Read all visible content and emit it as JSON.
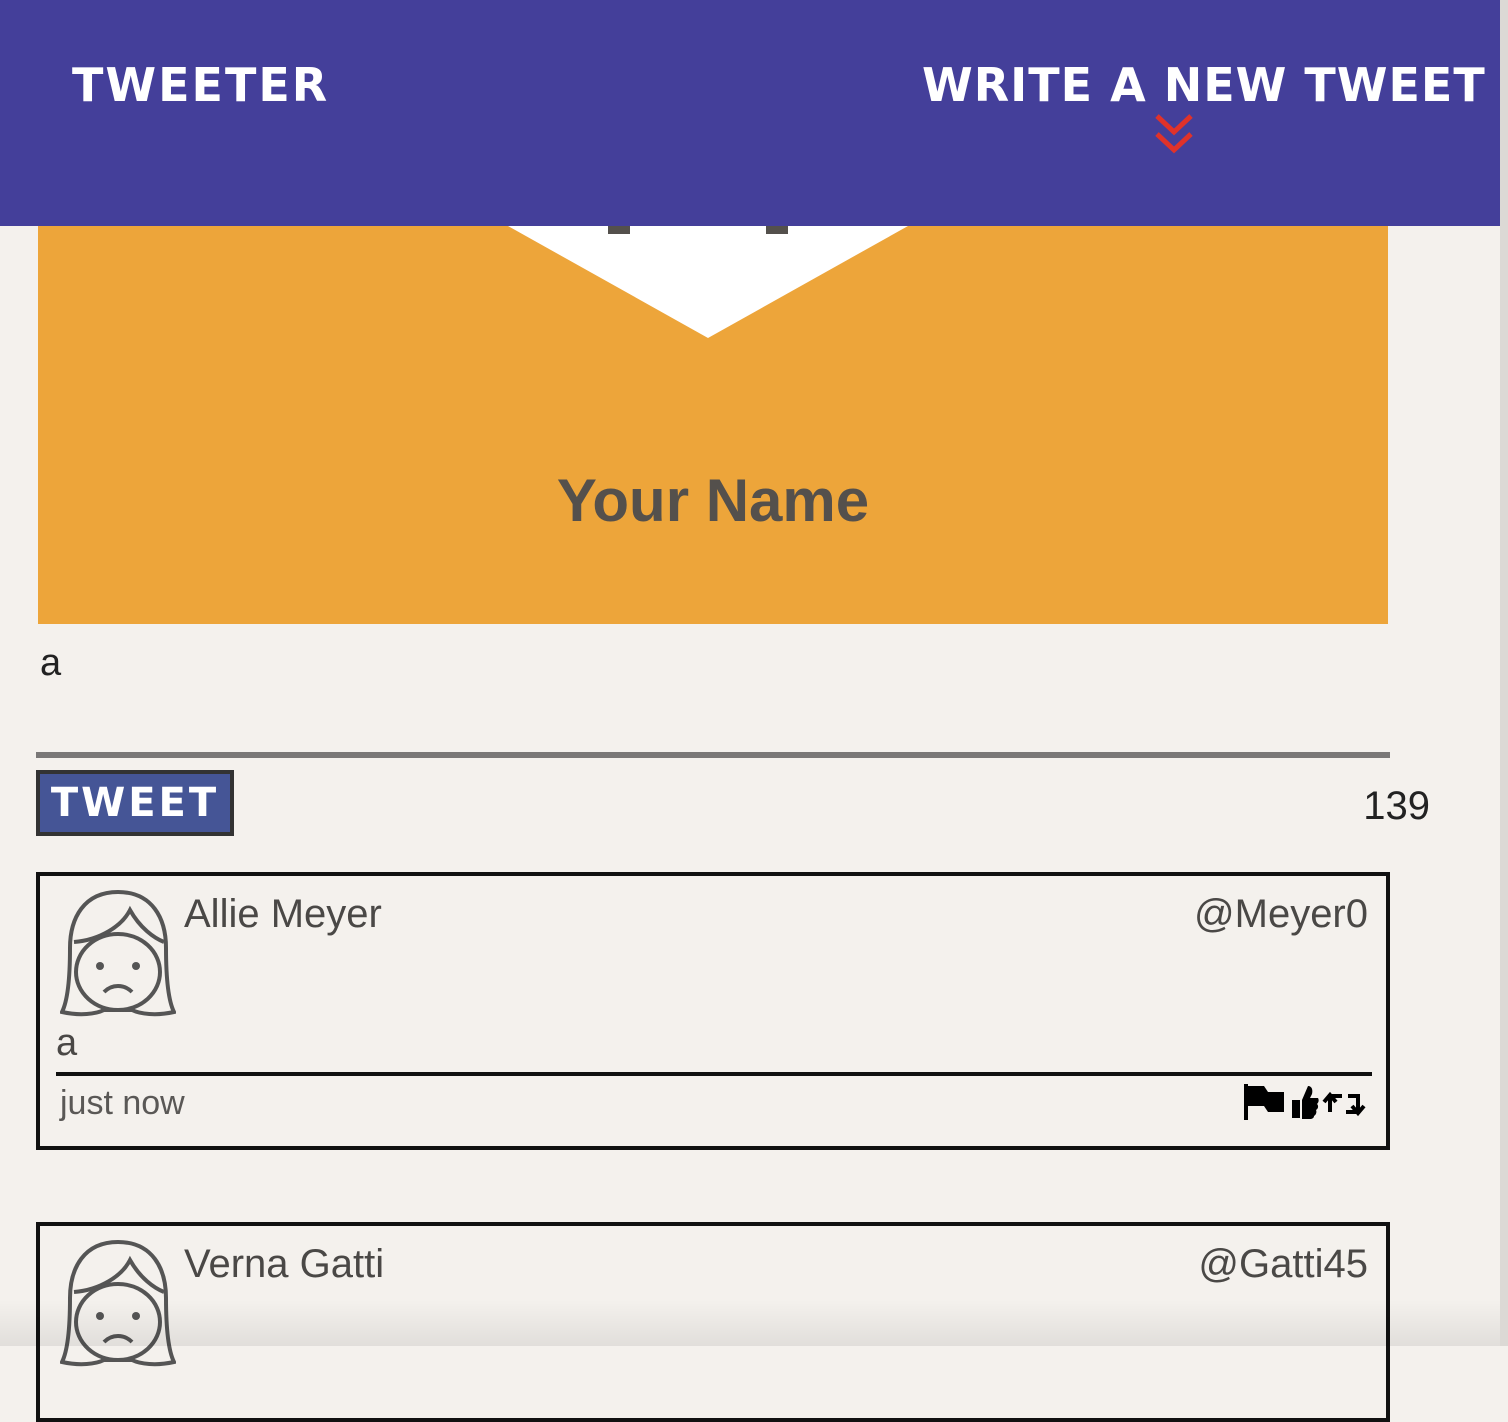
{
  "nav": {
    "brand": "Tweeter",
    "compose_link": "Write a new tweet",
    "chevron_icon": "double-chevron-down-icon",
    "chevron_color": "#e0322a",
    "bg_color": "#443f9a"
  },
  "profile": {
    "name": "Your Name",
    "banner_color": "#eda53a"
  },
  "composer": {
    "text": "a",
    "button_label": "Tweet",
    "char_count": "139"
  },
  "tweets": [
    {
      "author": "Allie Meyer",
      "handle": "@Meyer0",
      "content": "a",
      "time": "just now",
      "avatar_icon": "sad-girl-avatar-icon",
      "actions": [
        "flag-icon",
        "like-icon",
        "retweet-icon"
      ]
    },
    {
      "author": "Verna Gatti",
      "handle": "@Gatti45",
      "avatar_icon": "sad-girl-avatar-icon"
    }
  ]
}
